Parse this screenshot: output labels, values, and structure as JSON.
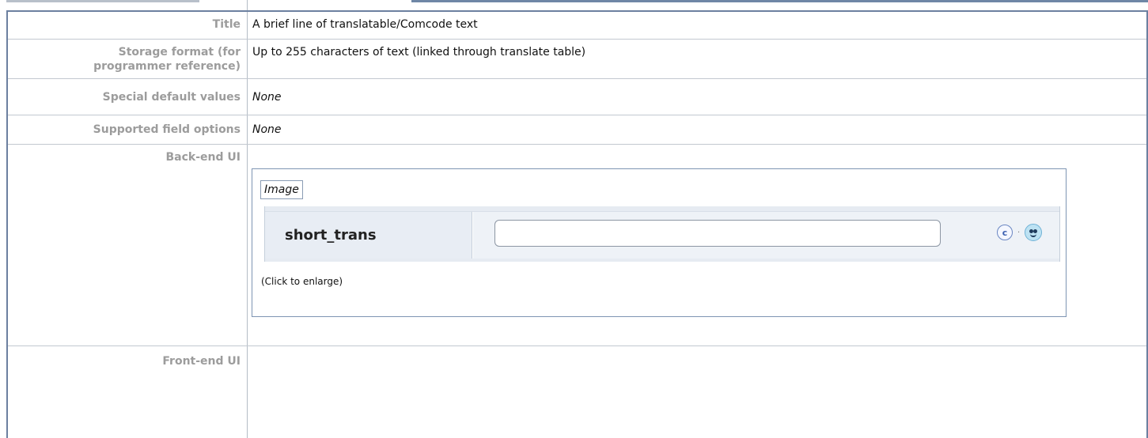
{
  "rows": {
    "title": {
      "label": "Title",
      "value": "A brief line of translatable/Comcode text"
    },
    "storage": {
      "label_line1": "Storage format (for",
      "label_line2": "programmer reference)",
      "value": "Up to 255 characters of text (linked through translate table)"
    },
    "special": {
      "label": "Special default values",
      "value": "None"
    },
    "supported": {
      "label": "Supported field options",
      "value": "None"
    },
    "backend": {
      "label": "Back-end UI"
    },
    "frontend": {
      "label": "Front-end UI"
    }
  },
  "backend_figure": {
    "caption": "Image",
    "field_name": "short_trans",
    "input_value": "",
    "comcode_icon_glyph": "c",
    "separator": "·",
    "enlarge_label": "(Click to enlarge)",
    "icons": [
      "comcode-icon",
      "emoticon-icon"
    ]
  },
  "colors": {
    "label_text": "#9c9c9c",
    "border_accent": "#6c80a0",
    "figure_border": "#7e95b3"
  }
}
